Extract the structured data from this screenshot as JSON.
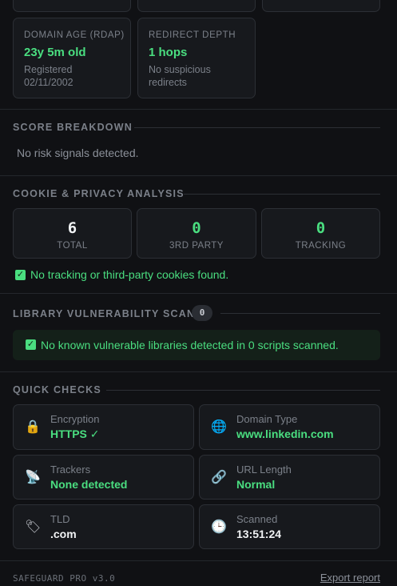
{
  "meta_cards": [
    {
      "label": "DOMAIN AGE (RDAP)",
      "value": "23y 5m old",
      "sub": "Registered 02/11/2002"
    },
    {
      "label": "REDIRECT DEPTH",
      "value": "1 hops",
      "sub": "No suspicious redirects"
    }
  ],
  "score": {
    "title": "SCORE BREAKDOWN",
    "message": "No risk signals detected."
  },
  "cookies": {
    "title": "COOKIE & PRIVACY ANALYSIS",
    "stats": [
      {
        "value": "6",
        "label": "TOTAL",
        "color": "#f1f3f5"
      },
      {
        "value": "0",
        "label": "3RD PARTY",
        "color": "#4ade80"
      },
      {
        "value": "0",
        "label": "TRACKING",
        "color": "#4ade80"
      }
    ],
    "check_icon": "check-icon",
    "message": "No tracking or third-party cookies found."
  },
  "libraries": {
    "title": "LIBRARY VULNERABILITY SCAN",
    "count": "0",
    "message": "No known vulnerable libraries detected in 0 scripts scanned."
  },
  "quick_checks": {
    "title": "QUICK CHECKS",
    "items": [
      {
        "icon": "lock-icon",
        "label": "Encryption",
        "value": "HTTPS ✓"
      },
      {
        "icon": "globe-icon",
        "label": "Domain Type",
        "value": "www.linkedin.com"
      },
      {
        "icon": "satellite-icon",
        "label": "Trackers",
        "value": "None detected"
      },
      {
        "icon": "link-icon",
        "label": "URL Length",
        "value": "Normal"
      },
      {
        "icon": "tag-icon",
        "label": "TLD",
        "value": ".com"
      },
      {
        "icon": "clock-icon",
        "label": "Scanned",
        "value": "13:51:24"
      }
    ]
  },
  "footer": {
    "brand": "SAFEGUARD PRO v3.0",
    "export_label": "Export report"
  },
  "colors": {
    "accent_green": "#4ade80",
    "background": "#101114",
    "card": "#17191d"
  }
}
